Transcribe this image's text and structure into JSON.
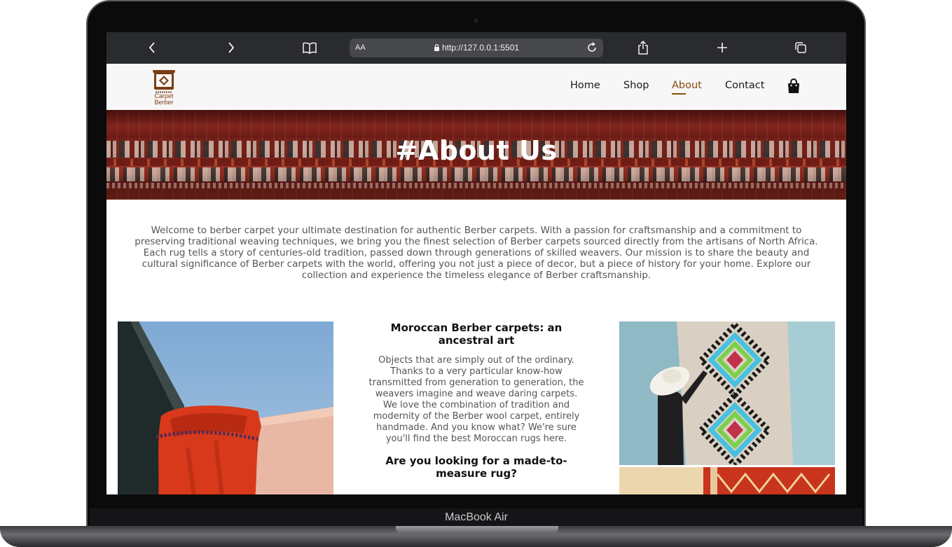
{
  "device": {
    "model_label": "MacBook Air"
  },
  "browser": {
    "text_size_label": "AA",
    "url": "http://127.0.0.1:5501",
    "icons": [
      "chevron-left-icon",
      "chevron-right-icon",
      "book-icon",
      "lock-icon",
      "reload-icon",
      "share-icon",
      "plus-icon",
      "tabs-icon"
    ]
  },
  "site": {
    "logo_text_line1": "Carpet",
    "logo_text_line2": "Berber",
    "nav": [
      {
        "label": "Home",
        "active": false
      },
      {
        "label": "Shop",
        "active": false
      },
      {
        "label": "About",
        "active": true
      },
      {
        "label": "Contact",
        "active": false
      }
    ],
    "cart_icon": "shopping-bag-icon",
    "accent_color": "#8a4a0c"
  },
  "hero": {
    "title": "#About Us"
  },
  "intro": {
    "text": "Welcome to berber carpet your ultimate destination for authentic Berber carpets. With a passion for craftsmanship and a commitment to preserving traditional weaving techniques, we bring you the finest selection of Berber carpets sourced directly from the artisans of North Africa. Each rug tells a story of centuries-old tradition, passed down through generations of skilled weavers. Our mission is to share the beauty and cultural significance of Berber carpets with the world, offering you not just a piece of decor, but a piece of history for your home. Explore our collection and experience the timeless elegance of Berber craftsmanship."
  },
  "article": {
    "heading1": "Moroccan Berber carpets: an ancestral art",
    "paragraph1": "Objects that are simply out of the ordinary. Thanks to a very particular know-how transmitted from generation to generation, the weavers imagine and weave daring carpets. We love the combination of tradition and modernity of the Berber wool carpet, entirely handmade. And you know what? We're sure you'll find the best Moroccan rugs here.",
    "heading2": "Are you looking for a made-to-measure rug?"
  }
}
